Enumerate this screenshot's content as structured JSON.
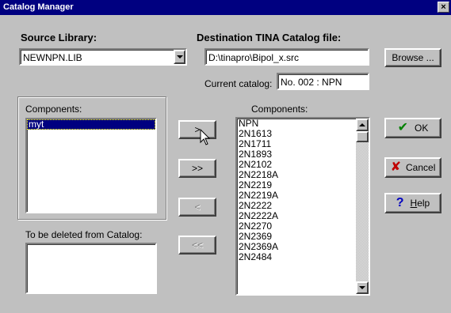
{
  "window": {
    "title": "Catalog Manager",
    "close_glyph": "×"
  },
  "source": {
    "label": "Source Library:",
    "value": "NEWNPN.LIB"
  },
  "destination": {
    "label": "Destination TINA Catalog file:",
    "value": "D:\\tinapro\\Bipol_x.src",
    "browse_label": "Browse ..."
  },
  "current_catalog": {
    "label": "Current catalog:",
    "value": "No. 002 : NPN"
  },
  "source_components": {
    "label": "Components:",
    "items": [
      "myt"
    ],
    "selected_index": 0
  },
  "deleted": {
    "label": "To be deleted from Catalog:",
    "items": []
  },
  "transfer_buttons": {
    "add": ">",
    "add_all": ">>",
    "remove": "<",
    "remove_all": "<<"
  },
  "dest_components": {
    "label": "Components:",
    "items": [
      "NPN",
      "2N1613",
      "2N1711",
      "2N1893",
      "2N2102",
      "2N2218A",
      "2N2219",
      "2N2219A",
      "2N2222",
      "2N2222A",
      "2N2270",
      "2N2369",
      "2N2369A",
      "2N2484"
    ]
  },
  "actions": {
    "ok": "OK",
    "cancel": "Cancel",
    "help": "Help"
  },
  "colors": {
    "face": "#c0c0c0",
    "titlebar": "#000080",
    "ok_check": "#008000",
    "cancel_x": "#c00000",
    "help_q": "#0000c0"
  }
}
